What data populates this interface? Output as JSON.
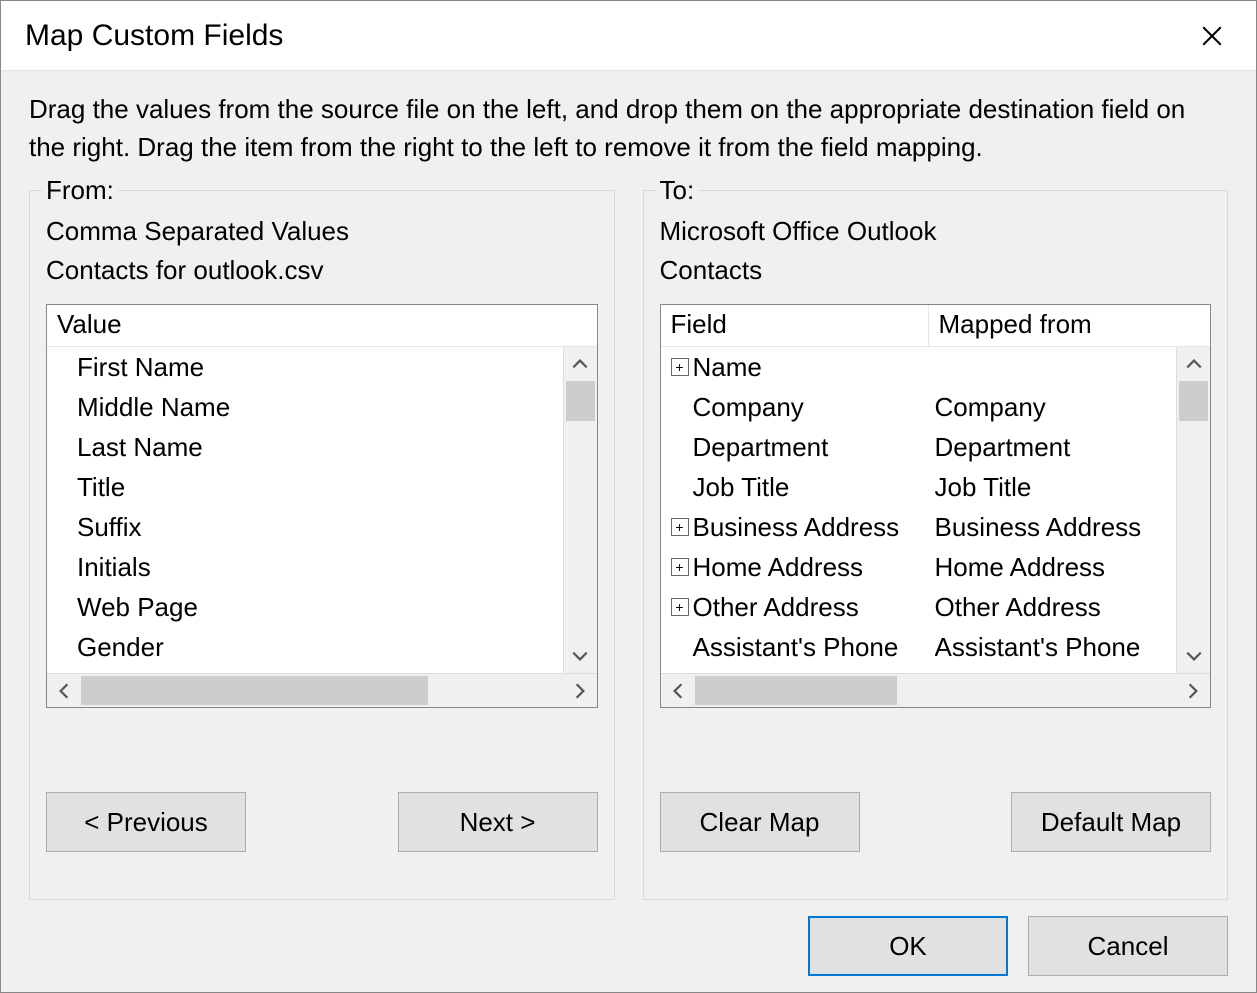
{
  "title": "Map Custom Fields",
  "instructions": "Drag the values from the source file on the left, and drop them on the appropriate destination field on the right.  Drag the item from the right to the left to remove it from the field mapping.",
  "from": {
    "label": "From:",
    "format": "Comma Separated Values",
    "file": "Contacts for outlook.csv",
    "header": "Value",
    "items": [
      "First Name",
      "Middle Name",
      "Last Name",
      "Title",
      "Suffix",
      "Initials",
      "Web Page",
      "Gender"
    ]
  },
  "to": {
    "label": "To:",
    "app": "Microsoft Office Outlook",
    "folder": "Contacts",
    "header_field": "Field",
    "header_mapped": "Mapped from",
    "items": [
      {
        "field": "Name",
        "mapped": "",
        "expandable": true,
        "indent": 0
      },
      {
        "field": "Company",
        "mapped": "Company",
        "expandable": false,
        "indent": 1
      },
      {
        "field": "Department",
        "mapped": "Department",
        "expandable": false,
        "indent": 1
      },
      {
        "field": "Job Title",
        "mapped": "Job Title",
        "expandable": false,
        "indent": 1
      },
      {
        "field": "Business Address",
        "mapped": "Business Address",
        "expandable": true,
        "indent": 0
      },
      {
        "field": "Home Address",
        "mapped": "Home Address",
        "expandable": true,
        "indent": 0
      },
      {
        "field": "Other Address",
        "mapped": "Other Address",
        "expandable": true,
        "indent": 0
      },
      {
        "field": "Assistant's Phone",
        "mapped": "Assistant's Phone",
        "expandable": false,
        "indent": 1
      }
    ]
  },
  "buttons": {
    "previous": "< Previous",
    "next": "Next >",
    "clear_map": "Clear Map",
    "default_map": "Default Map",
    "ok": "OK",
    "cancel": "Cancel"
  }
}
